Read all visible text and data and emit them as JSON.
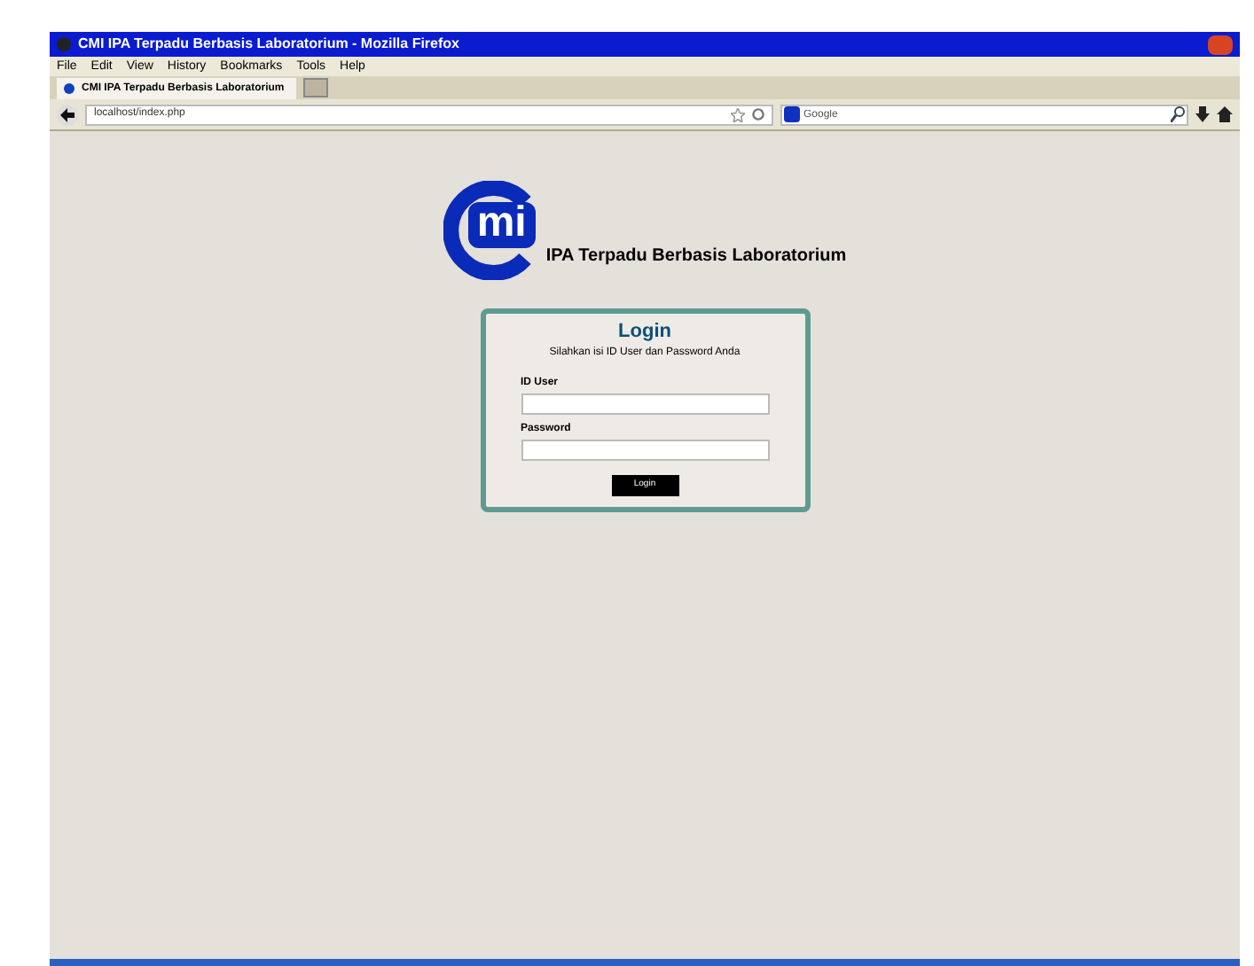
{
  "window": {
    "title": "CMI IPA Terpadu Berbasis Laboratorium - Mozilla Firefox"
  },
  "menu": [
    "File",
    "Edit",
    "View",
    "History",
    "Bookmarks",
    "Tools",
    "Help"
  ],
  "tabs": [
    {
      "label": "CMI IPA Terpadu Berbasis Laboratorium",
      "selected": true
    }
  ],
  "address_bar": {
    "value": "localhost/index.php"
  },
  "search": {
    "placeholder": "Google"
  },
  "page": {
    "logo_text": "mi",
    "site_title": "IPA Terpadu Berbasis Laboratorium",
    "login": {
      "title": "Login",
      "subtitle": "Silahkan isi ID User dan Password Anda",
      "fields": [
        {
          "label": "ID User"
        },
        {
          "label": "Password"
        }
      ],
      "button": "Login"
    }
  }
}
